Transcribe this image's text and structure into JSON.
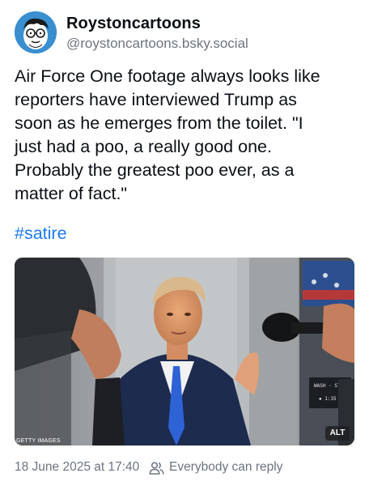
{
  "author": {
    "display_name": "Roystoncartoons",
    "handle": "@roystoncartoons.bsky.social"
  },
  "post": {
    "text": "Air Force One footage always looks like\nreporters have interviewed Trump as\nsoon as he emerges from the toilet. \"I\njust had a poo, a really good one.\nProbably the greatest poo ever, as a\nmatter of fact.\"",
    "hashtag": "#satire"
  },
  "media": {
    "credit": "GETTY IMAGES",
    "alt_label": "ALT",
    "screen_line1": "WASH · STON",
    "screen_line2": "▪ 1:35"
  },
  "footer": {
    "timestamp": "18 June 2025 at 17:40",
    "reply_setting": "Everybody can reply",
    "people_icon": "people-icon"
  },
  "colors": {
    "hashtag": "#1d7af0",
    "muted": "#6b7480",
    "avatar_bg": "#3a8fd0"
  }
}
